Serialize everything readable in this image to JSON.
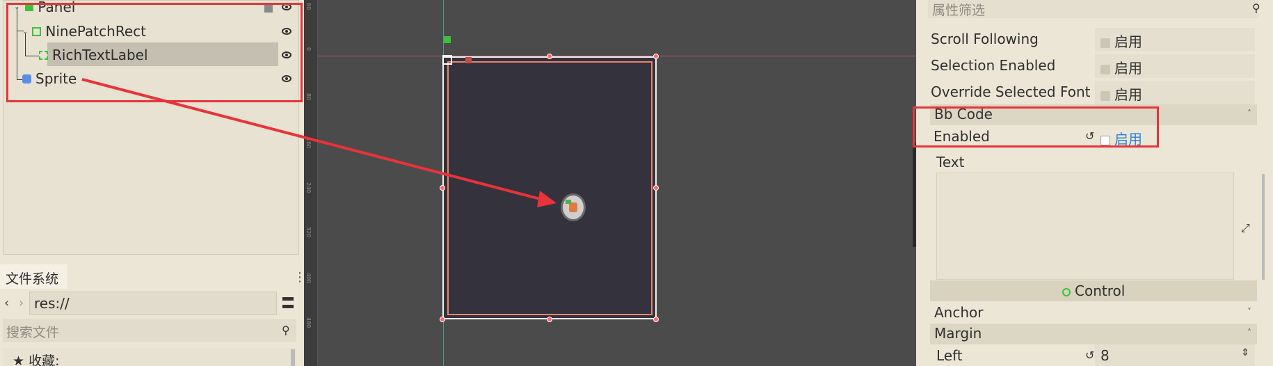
{
  "scene_tree": {
    "items": [
      {
        "label": "Panel",
        "icon": "panel-icon"
      },
      {
        "label": "NinePatchRect",
        "icon": "ninepatch-icon"
      },
      {
        "label": "RichTextLabel",
        "icon": "richtext-icon"
      },
      {
        "label": "Sprite",
        "icon": "sprite-icon"
      }
    ]
  },
  "filesystem": {
    "tab_label": "文件系统",
    "path": "res://",
    "search_placeholder": "搜索文件",
    "favorites_label": "收藏:"
  },
  "ruler": {
    "labels": [
      "80",
      "0",
      "80",
      "160",
      "240",
      "320",
      "400",
      "480"
    ]
  },
  "inspector": {
    "filter_placeholder": "属性筛选",
    "props": [
      {
        "label": "Scroll Following",
        "value": "启用"
      },
      {
        "label": "Selection Enabled",
        "value": "启用"
      },
      {
        "label": "Override Selected Font",
        "value": "启用"
      }
    ],
    "bbcode_section": "Bb Code",
    "enabled_label": "Enabled",
    "enabled_value": "启用",
    "text_label": "Text",
    "control_section": "Control",
    "anchor_label": "Anchor",
    "margin_label": "Margin",
    "left_label": "Left",
    "left_value": "8"
  },
  "colors": {
    "highlight": "#e8333a",
    "enabled_value": "#2b7fd6",
    "control_icon": "#3cc13c"
  }
}
